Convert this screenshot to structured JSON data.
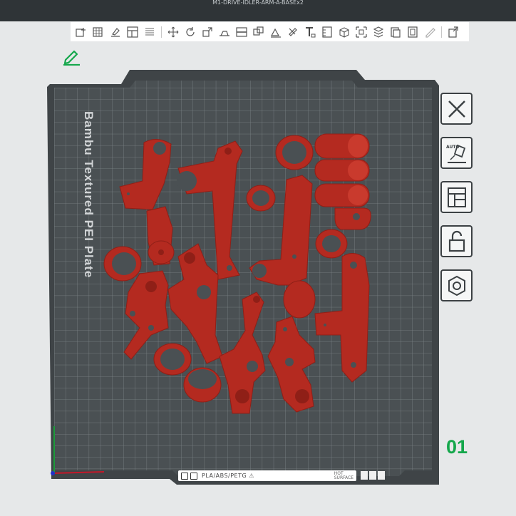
{
  "window": {
    "title": "M1-DRIVE-IDLER-ARM-A-BASEx2"
  },
  "toolbar": {
    "icons": [
      "add-object-icon",
      "add-plate-icon",
      "auto-orient-icon",
      "arrange-icon",
      "split-icon",
      "move-icon",
      "rotate-icon",
      "scale-icon",
      "lay-on-face-icon",
      "cut-icon",
      "boolean-icon",
      "support-paint-icon",
      "seam-paint-icon",
      "text-icon",
      "measure-icon",
      "assembly-icon",
      "fit-icon",
      "variable-layer-icon",
      "color-paint-icon",
      "mesh-icon",
      "brim-ear-icon",
      "settings-icon"
    ]
  },
  "bed": {
    "plate_name": "Bambu Textured PEI Plate",
    "plate_number": "01",
    "filament_label": "PLA/ABS/PETG",
    "hot_surface_label": "HOT\nSURFACE"
  },
  "side_buttons": [
    {
      "name": "close-icon",
      "label": ""
    },
    {
      "name": "auto-orient-icon",
      "label": "AUTO"
    },
    {
      "name": "arrange-icon",
      "label": ""
    },
    {
      "name": "lock-icon",
      "label": ""
    },
    {
      "name": "plate-settings-icon",
      "label": ""
    }
  ],
  "colors": {
    "part": "#b42a20",
    "part_shade": "#8f1f17",
    "plate": "#4a5053",
    "grid": "#7d8487",
    "accent": "#14a74b",
    "x_axis": "#c4182a",
    "y_axis": "#1c9b3a",
    "z_axis": "#2030c8"
  }
}
